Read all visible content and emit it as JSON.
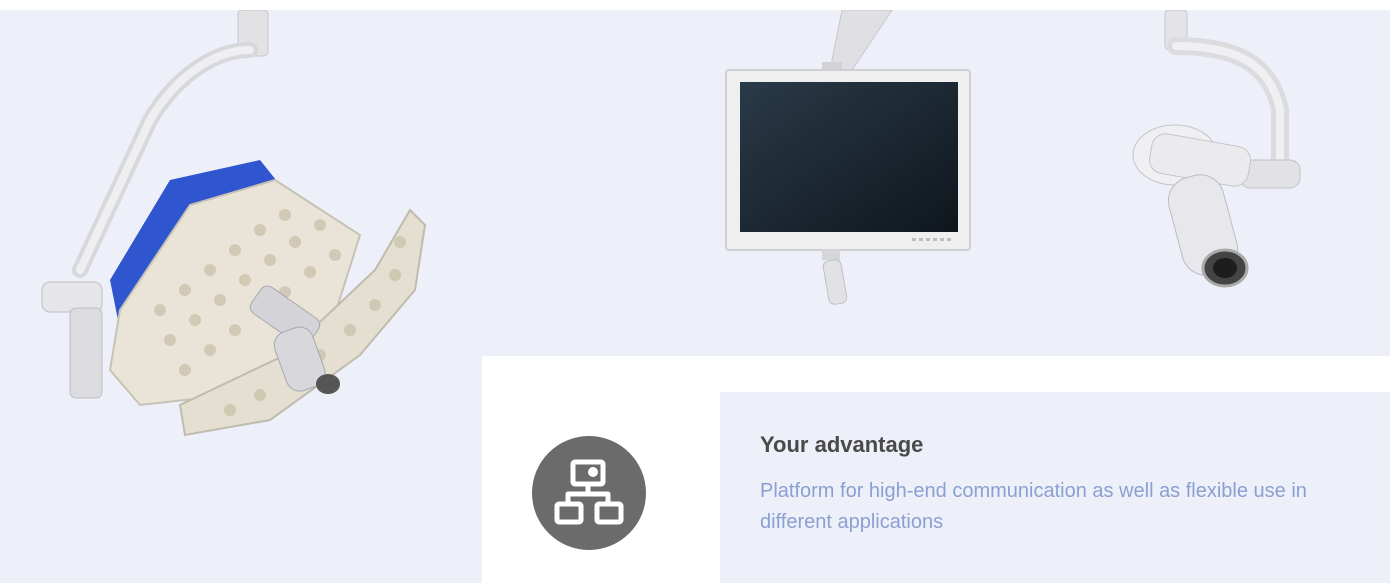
{
  "advantage": {
    "title": "Your advantage",
    "text": "Platform for high-end communication as well as flexible use in different applications"
  },
  "icon": "network-hierarchy-icon",
  "colors": {
    "background": "#eef0f9",
    "icon_circle": "#6b6b6b",
    "title": "#4a4a4a",
    "text": "#8a9fd2",
    "lamp_accent": "#2b4fc9"
  },
  "products": [
    "surgical-light",
    "monitor",
    "camera"
  ]
}
